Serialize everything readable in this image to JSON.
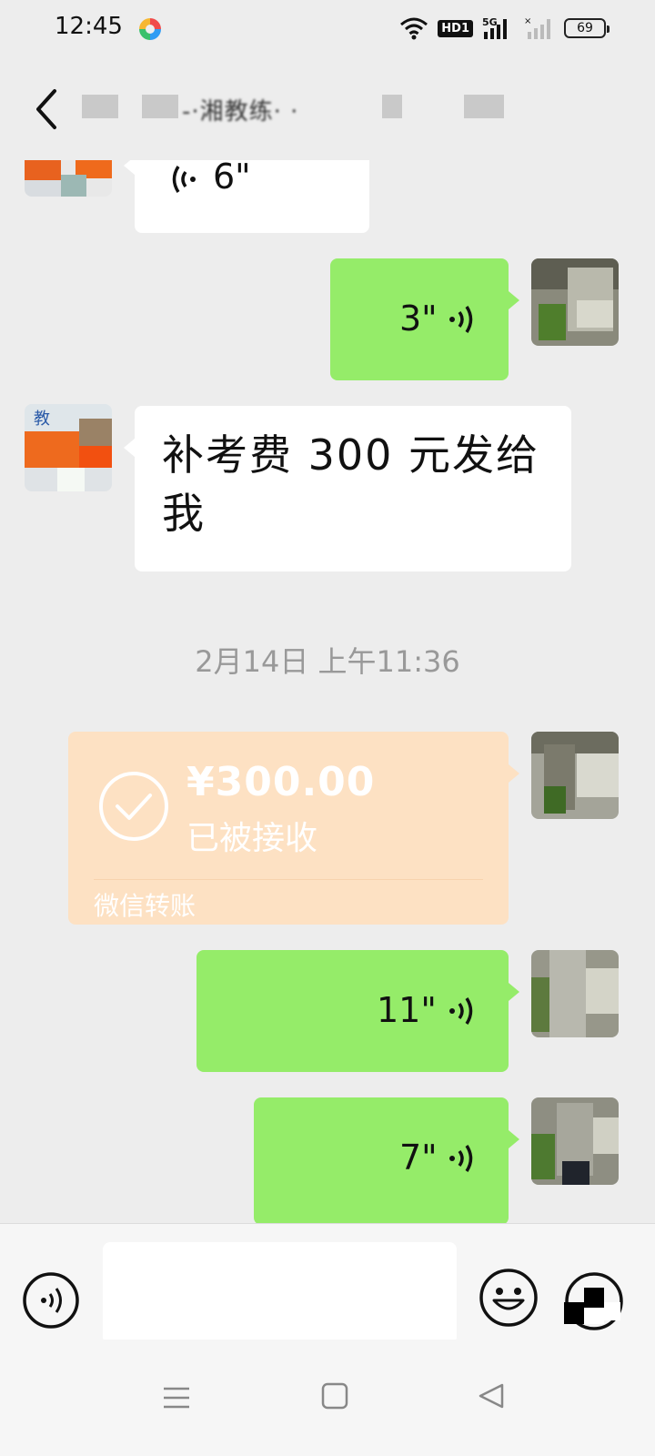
{
  "status_bar": {
    "time": "12:45",
    "app_icon": "pinwheel-app-icon",
    "network_badge": "HD1",
    "signal_label": "5G",
    "battery_level": "69"
  },
  "header": {
    "title": "-·湘教练· ·",
    "back_icon": "chevron-left-icon"
  },
  "messages": [
    {
      "type": "voice",
      "direction": "incoming",
      "duration": "6\""
    },
    {
      "type": "voice",
      "direction": "outgoing",
      "duration": "3\""
    },
    {
      "type": "text",
      "direction": "incoming",
      "text": "补考费 300 元发给我"
    },
    {
      "type": "timestamp",
      "text": "2月14日 上午11:36"
    },
    {
      "type": "transfer",
      "direction": "outgoing",
      "amount": "¥300.00",
      "status": "已被接收",
      "label": "微信转账"
    },
    {
      "type": "voice",
      "direction": "outgoing",
      "duration": "11\""
    },
    {
      "type": "voice",
      "direction": "outgoing",
      "duration": "7\""
    }
  ],
  "input_bar": {
    "value": "",
    "placeholder": "",
    "voice_icon": "voice-input-icon",
    "emoji_icon": "emoji-icon",
    "more_icon": "plus-circle-icon"
  },
  "nav_bar": {
    "menu_icon": "menu-icon",
    "home_icon": "home-square-icon",
    "back_icon": "back-triangle-icon"
  },
  "colors": {
    "background": "#ededed",
    "bubble_outgoing": "#95ec69",
    "bubble_incoming": "#ffffff",
    "transfer_card": "#fde1c3",
    "timestamp": "#999999"
  }
}
